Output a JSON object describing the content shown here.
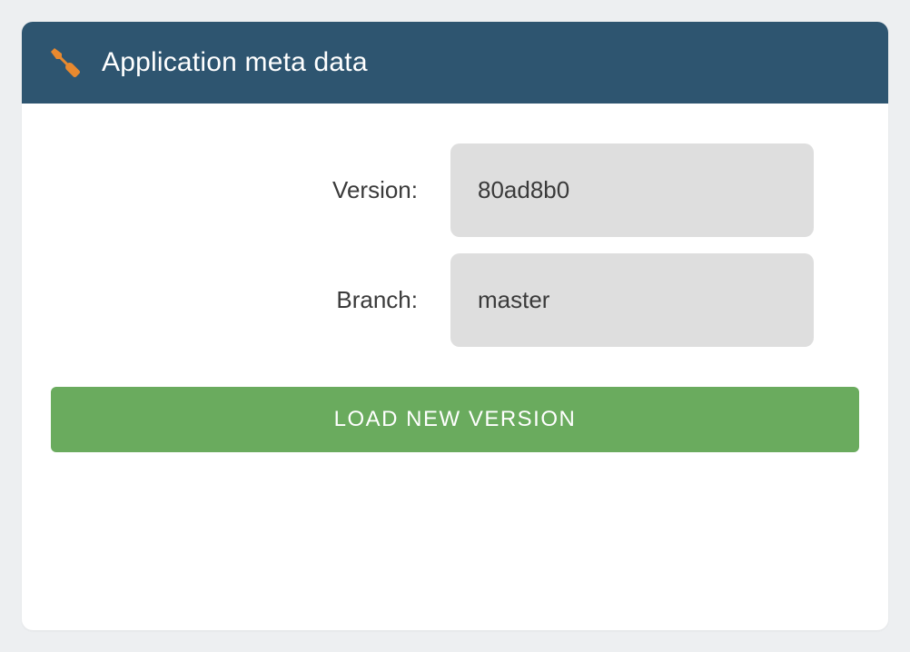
{
  "header": {
    "title": "Application meta data",
    "icon": "wrench-icon"
  },
  "fields": {
    "version": {
      "label": "Version:",
      "value": "80ad8b0"
    },
    "branch": {
      "label": "Branch:",
      "value": "master"
    }
  },
  "actions": {
    "load_button_label": "LOAD NEW VERSION"
  },
  "colors": {
    "header_bg": "#2e5570",
    "icon_fill": "#e8892f",
    "button_bg": "#6aab5e",
    "field_bg": "#dedede"
  }
}
